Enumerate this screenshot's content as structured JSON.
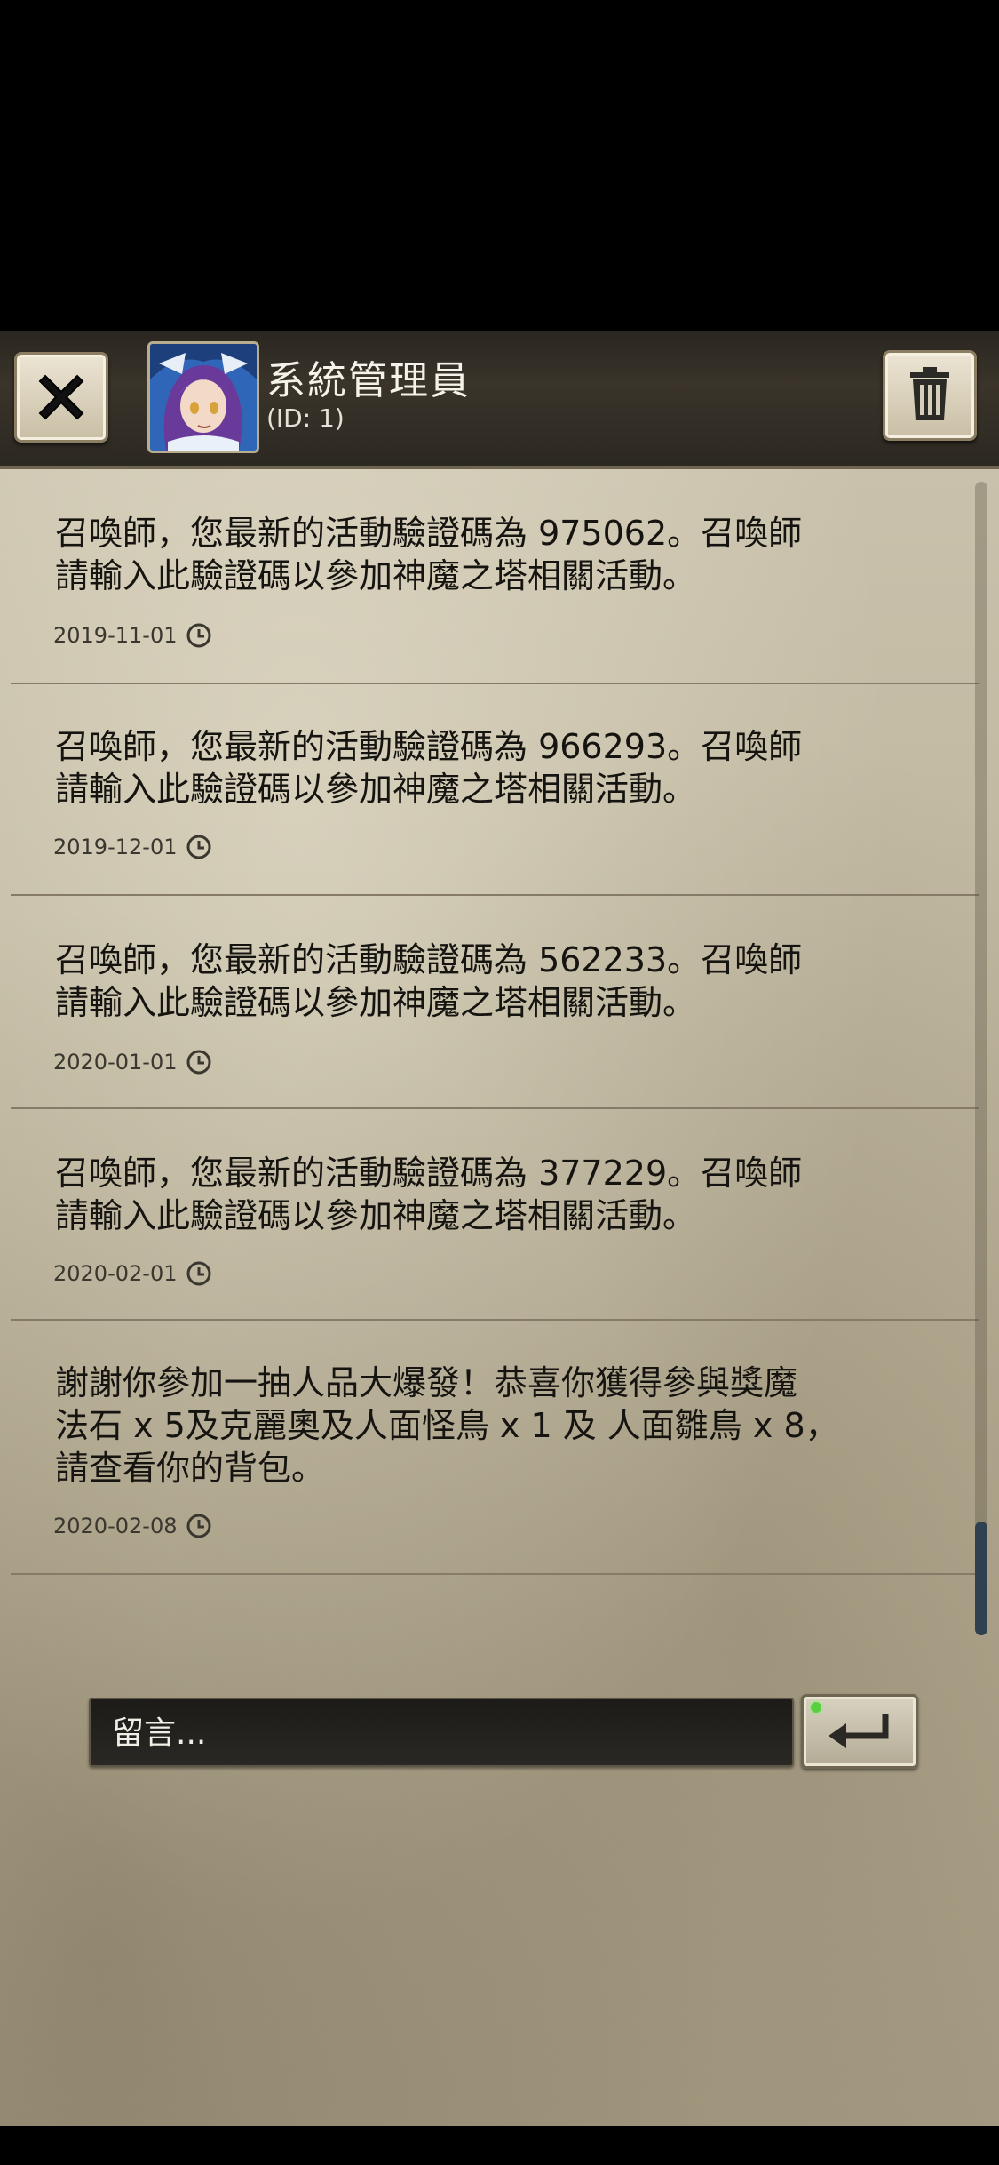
{
  "header": {
    "sender_name": "系統管理員",
    "sender_id": "(ID: 1)"
  },
  "messages": [
    {
      "text": "召喚師，您最新的活動驗證碼為 975062。召喚師\n請輸入此驗證碼以參加神魔之塔相關活動。",
      "date": "2019-11-01"
    },
    {
      "text": "召喚師，您最新的活動驗證碼為 966293。召喚師\n請輸入此驗證碼以參加神魔之塔相關活動。",
      "date": "2019-12-01"
    },
    {
      "text": "召喚師，您最新的活動驗證碼為 562233。召喚師\n請輸入此驗證碼以參加神魔之塔相關活動。",
      "date": "2020-01-01"
    },
    {
      "text": "召喚師，您最新的活動驗證碼為 377229。召喚師\n請輸入此驗證碼以參加神魔之塔相關活動。",
      "date": "2020-02-01"
    },
    {
      "text": "謝謝你參加一抽人品大爆發！恭喜你獲得參與獎魔\n法石 x 5及克麗奧及人面怪鳥 x 1 及 人面雛鳥 x 8，\n請查看你的背包。",
      "date": "2020-02-08"
    }
  ],
  "composer": {
    "placeholder": "留言..."
  },
  "icons": {
    "close": "close-x-icon",
    "trash": "trash-icon",
    "clock": "clock-icon",
    "send": "enter-return-icon"
  },
  "colors": {
    "parchment": "#bdb59c",
    "header": "#2a2620",
    "text": "#161410",
    "scroll_thumb": "#2f4150"
  }
}
